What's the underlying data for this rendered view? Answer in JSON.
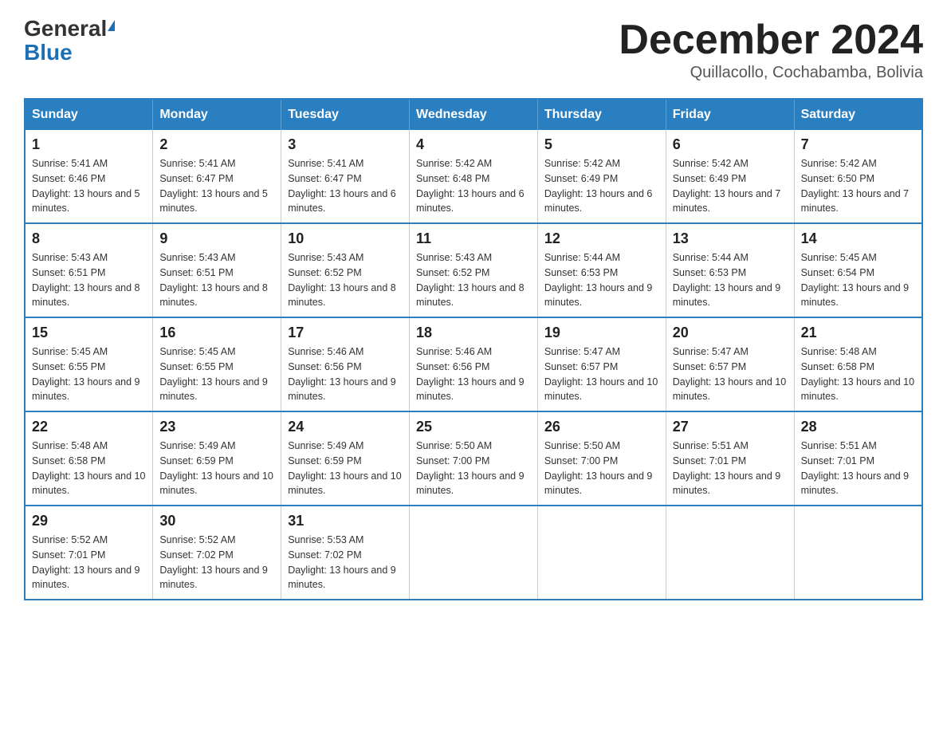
{
  "header": {
    "logo_general": "General",
    "logo_blue": "Blue",
    "month_title": "December 2024",
    "location": "Quillacollo, Cochabamba, Bolivia"
  },
  "days_of_week": [
    "Sunday",
    "Monday",
    "Tuesday",
    "Wednesday",
    "Thursday",
    "Friday",
    "Saturday"
  ],
  "weeks": [
    [
      {
        "day": "1",
        "sunrise": "5:41 AM",
        "sunset": "6:46 PM",
        "daylight": "13 hours and 5 minutes."
      },
      {
        "day": "2",
        "sunrise": "5:41 AM",
        "sunset": "6:47 PM",
        "daylight": "13 hours and 5 minutes."
      },
      {
        "day": "3",
        "sunrise": "5:41 AM",
        "sunset": "6:47 PM",
        "daylight": "13 hours and 6 minutes."
      },
      {
        "day": "4",
        "sunrise": "5:42 AM",
        "sunset": "6:48 PM",
        "daylight": "13 hours and 6 minutes."
      },
      {
        "day": "5",
        "sunrise": "5:42 AM",
        "sunset": "6:49 PM",
        "daylight": "13 hours and 6 minutes."
      },
      {
        "day": "6",
        "sunrise": "5:42 AM",
        "sunset": "6:49 PM",
        "daylight": "13 hours and 7 minutes."
      },
      {
        "day": "7",
        "sunrise": "5:42 AM",
        "sunset": "6:50 PM",
        "daylight": "13 hours and 7 minutes."
      }
    ],
    [
      {
        "day": "8",
        "sunrise": "5:43 AM",
        "sunset": "6:51 PM",
        "daylight": "13 hours and 8 minutes."
      },
      {
        "day": "9",
        "sunrise": "5:43 AM",
        "sunset": "6:51 PM",
        "daylight": "13 hours and 8 minutes."
      },
      {
        "day": "10",
        "sunrise": "5:43 AM",
        "sunset": "6:52 PM",
        "daylight": "13 hours and 8 minutes."
      },
      {
        "day": "11",
        "sunrise": "5:43 AM",
        "sunset": "6:52 PM",
        "daylight": "13 hours and 8 minutes."
      },
      {
        "day": "12",
        "sunrise": "5:44 AM",
        "sunset": "6:53 PM",
        "daylight": "13 hours and 9 minutes."
      },
      {
        "day": "13",
        "sunrise": "5:44 AM",
        "sunset": "6:53 PM",
        "daylight": "13 hours and 9 minutes."
      },
      {
        "day": "14",
        "sunrise": "5:45 AM",
        "sunset": "6:54 PM",
        "daylight": "13 hours and 9 minutes."
      }
    ],
    [
      {
        "day": "15",
        "sunrise": "5:45 AM",
        "sunset": "6:55 PM",
        "daylight": "13 hours and 9 minutes."
      },
      {
        "day": "16",
        "sunrise": "5:45 AM",
        "sunset": "6:55 PM",
        "daylight": "13 hours and 9 minutes."
      },
      {
        "day": "17",
        "sunrise": "5:46 AM",
        "sunset": "6:56 PM",
        "daylight": "13 hours and 9 minutes."
      },
      {
        "day": "18",
        "sunrise": "5:46 AM",
        "sunset": "6:56 PM",
        "daylight": "13 hours and 9 minutes."
      },
      {
        "day": "19",
        "sunrise": "5:47 AM",
        "sunset": "6:57 PM",
        "daylight": "13 hours and 10 minutes."
      },
      {
        "day": "20",
        "sunrise": "5:47 AM",
        "sunset": "6:57 PM",
        "daylight": "13 hours and 10 minutes."
      },
      {
        "day": "21",
        "sunrise": "5:48 AM",
        "sunset": "6:58 PM",
        "daylight": "13 hours and 10 minutes."
      }
    ],
    [
      {
        "day": "22",
        "sunrise": "5:48 AM",
        "sunset": "6:58 PM",
        "daylight": "13 hours and 10 minutes."
      },
      {
        "day": "23",
        "sunrise": "5:49 AM",
        "sunset": "6:59 PM",
        "daylight": "13 hours and 10 minutes."
      },
      {
        "day": "24",
        "sunrise": "5:49 AM",
        "sunset": "6:59 PM",
        "daylight": "13 hours and 10 minutes."
      },
      {
        "day": "25",
        "sunrise": "5:50 AM",
        "sunset": "7:00 PM",
        "daylight": "13 hours and 9 minutes."
      },
      {
        "day": "26",
        "sunrise": "5:50 AM",
        "sunset": "7:00 PM",
        "daylight": "13 hours and 9 minutes."
      },
      {
        "day": "27",
        "sunrise": "5:51 AM",
        "sunset": "7:01 PM",
        "daylight": "13 hours and 9 minutes."
      },
      {
        "day": "28",
        "sunrise": "5:51 AM",
        "sunset": "7:01 PM",
        "daylight": "13 hours and 9 minutes."
      }
    ],
    [
      {
        "day": "29",
        "sunrise": "5:52 AM",
        "sunset": "7:01 PM",
        "daylight": "13 hours and 9 minutes."
      },
      {
        "day": "30",
        "sunrise": "5:52 AM",
        "sunset": "7:02 PM",
        "daylight": "13 hours and 9 minutes."
      },
      {
        "day": "31",
        "sunrise": "5:53 AM",
        "sunset": "7:02 PM",
        "daylight": "13 hours and 9 minutes."
      },
      null,
      null,
      null,
      null
    ]
  ],
  "labels": {
    "sunrise": "Sunrise:",
    "sunset": "Sunset:",
    "daylight": "Daylight:"
  }
}
